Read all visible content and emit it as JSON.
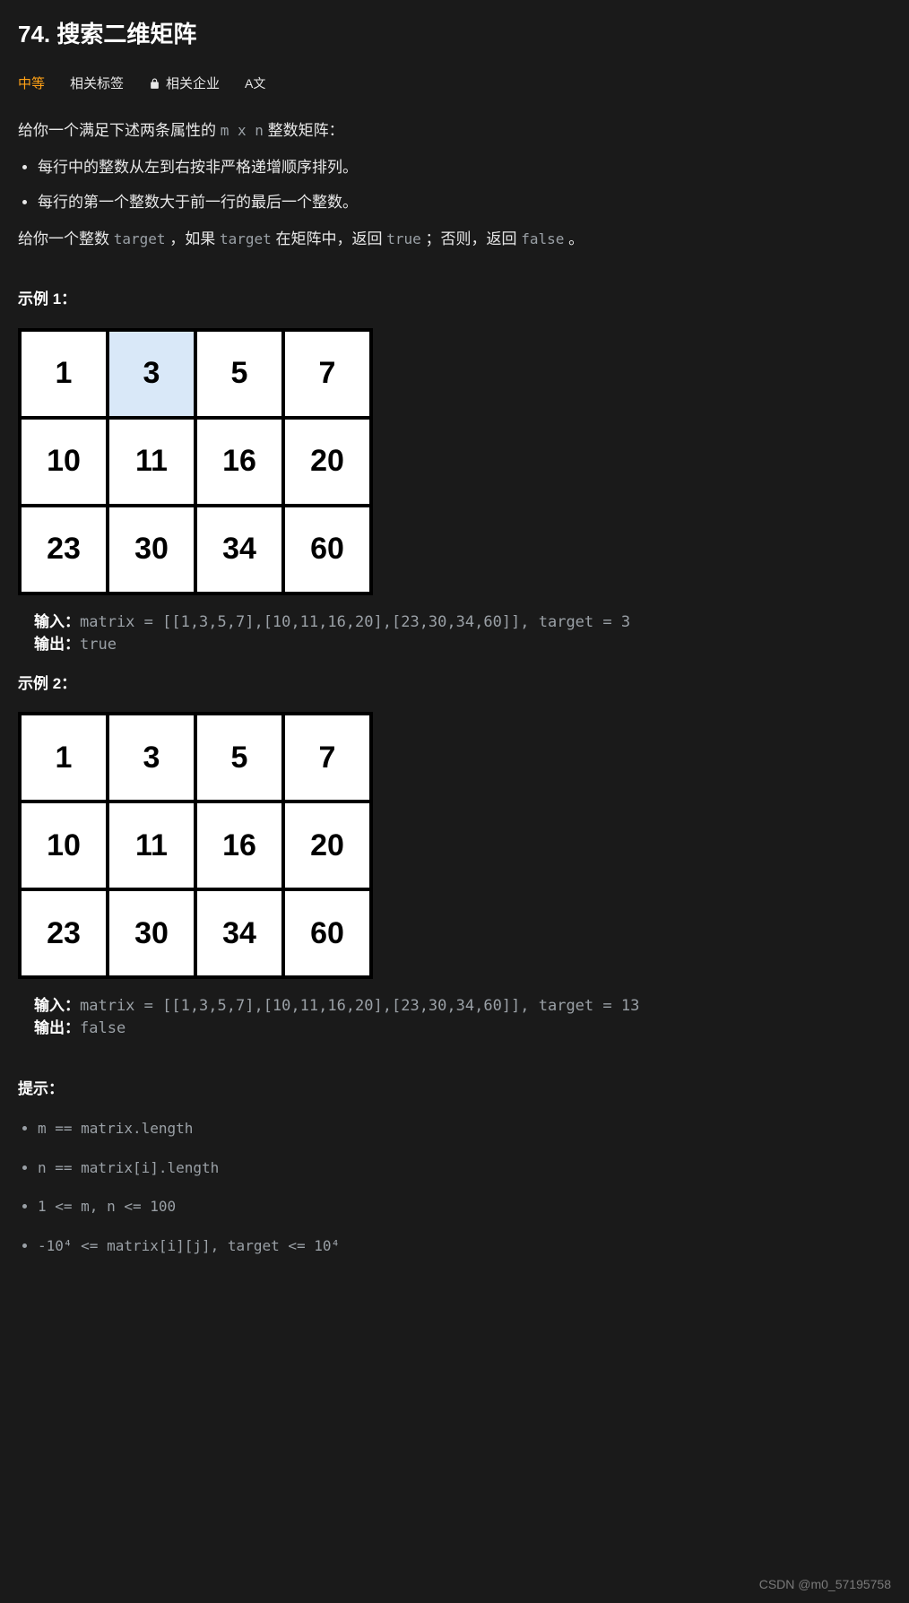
{
  "title": "74. 搜索二维矩阵",
  "tabs": {
    "difficulty": "中等",
    "tags": "相关标签",
    "companies": "相关企业",
    "translate": "A文"
  },
  "desc": {
    "line1_before": "给你一个满足下述两条属性的 ",
    "line1_code": "m x n",
    "line1_after": " 整数矩阵：",
    "bullet1": "每行中的整数从左到右按非严格递增顺序排列。",
    "bullet2": "每行的第一个整数大于前一行的最后一个整数。",
    "line2_p1": "给你一个整数 ",
    "line2_c1": "target",
    "line2_p2": " ，如果 ",
    "line2_c2": "target",
    "line2_p3": " 在矩阵中，返回 ",
    "line2_c3": "true",
    "line2_p4": " ；否则，返回 ",
    "line2_c4": "false",
    "line2_p5": " 。"
  },
  "example1": {
    "title": "示例 1：",
    "matrix": [
      [
        1,
        3,
        5,
        7
      ],
      [
        10,
        11,
        16,
        20
      ],
      [
        23,
        30,
        34,
        60
      ]
    ],
    "highlight": [
      0,
      1
    ],
    "input_label": "输入：",
    "input_value": "matrix = [[1,3,5,7],[10,11,16,20],[23,30,34,60]], target = 3",
    "output_label": "输出：",
    "output_value": "true"
  },
  "example2": {
    "title": "示例 2：",
    "matrix": [
      [
        1,
        3,
        5,
        7
      ],
      [
        10,
        11,
        16,
        20
      ],
      [
        23,
        30,
        34,
        60
      ]
    ],
    "highlight": null,
    "input_label": "输入：",
    "input_value": "matrix = [[1,3,5,7],[10,11,16,20],[23,30,34,60]], target = 13",
    "output_label": "输出：",
    "output_value": "false"
  },
  "hints": {
    "title": "提示：",
    "items": [
      "m == matrix.length",
      "n == matrix[i].length",
      "1 <= m, n <= 100",
      "-10⁴ <= matrix[i][j], target <= 10⁴"
    ]
  },
  "watermark": "CSDN @m0_57195758"
}
